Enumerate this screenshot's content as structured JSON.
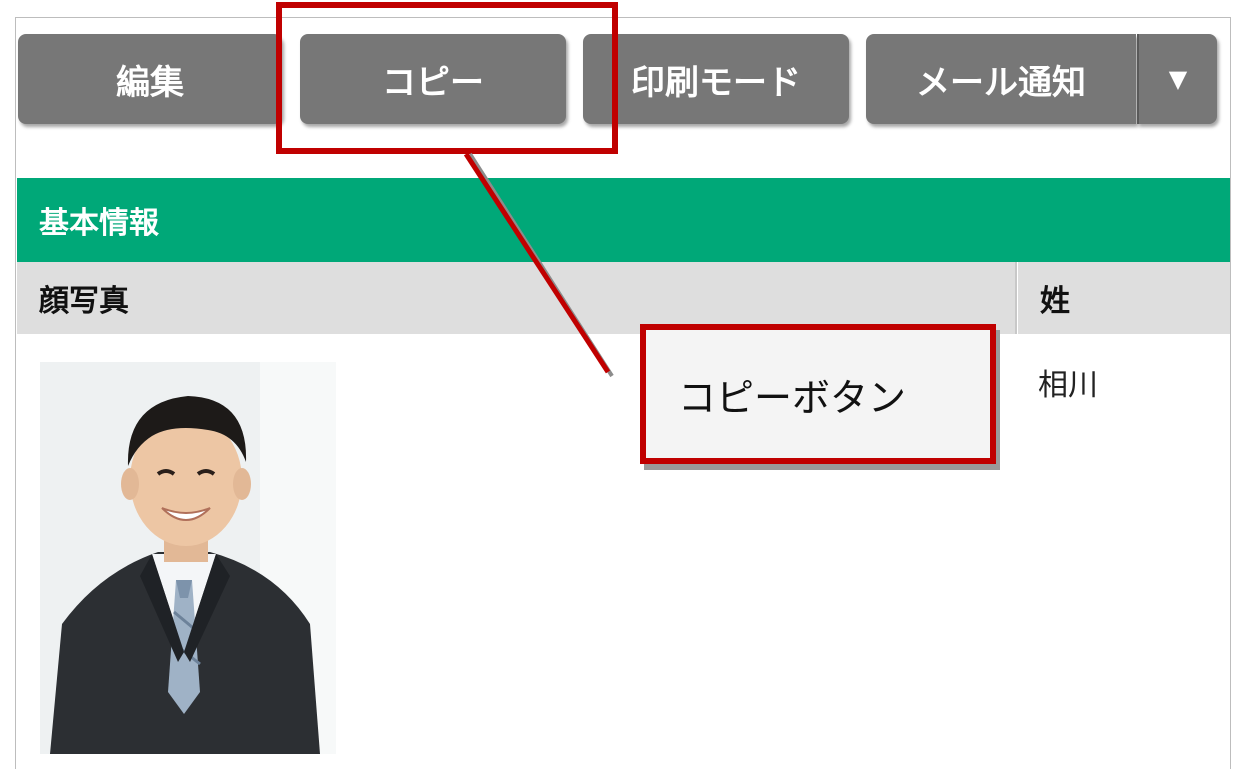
{
  "toolbar": {
    "edit_label": "編集",
    "copy_label": "コピー",
    "print_label": "印刷モード",
    "mail_label": "メール通知",
    "dropdown_glyph": "▼"
  },
  "section": {
    "title": "基本情報",
    "columns": [
      "顔写真",
      "姓"
    ],
    "values": {
      "last_name": "相川"
    }
  },
  "annotation": {
    "callout_text": "コピーボタン",
    "color": "#c00000"
  },
  "colors": {
    "button_bg": "#777777",
    "section_header_bg": "#00a878",
    "column_header_bg": "#dedede"
  }
}
